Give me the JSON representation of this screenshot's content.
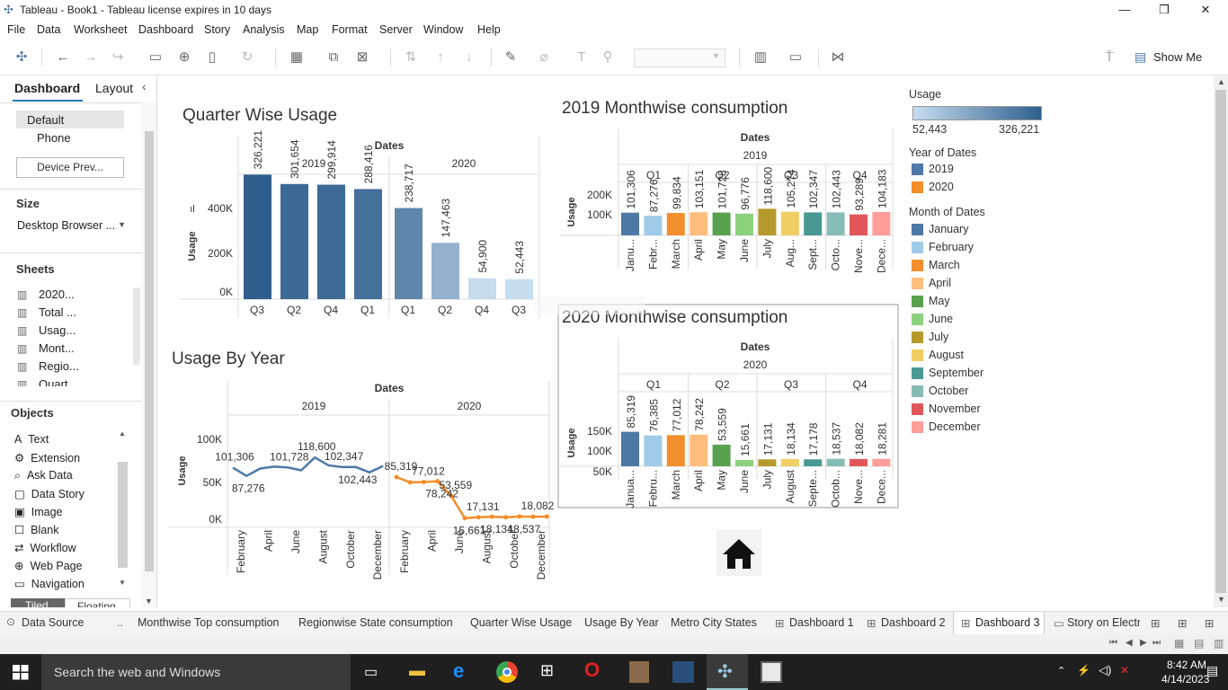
{
  "window": {
    "title": "Tableau - Book1 - Tableau license expires in 10 days"
  },
  "menu": [
    "File",
    "Data",
    "Worksheet",
    "Dashboard",
    "Story",
    "Analysis",
    "Map",
    "Format",
    "Server",
    "Window",
    "Help"
  ],
  "toolbar": {
    "show_me": "Show Me"
  },
  "left": {
    "tabs": [
      "Dashboard",
      "Layout"
    ],
    "device": [
      "Default",
      "Phone"
    ],
    "device_preview": "Device Prev...",
    "size_label": "Size",
    "size_value": "Desktop Browser ...",
    "sheets_label": "Sheets",
    "sheets": [
      "2020...",
      "Total ...",
      "Usag...",
      "Mont...",
      "Regio...",
      "Quart"
    ],
    "objects_label": "Objects",
    "objects": [
      "Text",
      "Extension",
      "Ask Data",
      "Data Story",
      "Image",
      "Blank",
      "Workflow",
      "Web Page",
      "Navigation"
    ],
    "layout_tabs": [
      "Tiled",
      "Floating"
    ]
  },
  "sheet_tabs": [
    "Data Source",
    "Monthwise Top consumption",
    "Regionwise State consumption",
    "Quarter Wise Usage",
    "Usage By Year",
    "Metro City States",
    "Dashboard 1",
    "Dashboard 2",
    "Dashboard 3",
    "Story on Electr"
  ],
  "taskbar": {
    "search": "Search the web and Windows",
    "time": "8:42 AM",
    "date": "4/14/2023"
  },
  "legend": {
    "usage_title": "Usage",
    "usage_min": "52,443",
    "usage_max": "326,221",
    "year_title": "Year of Dates",
    "years": [
      {
        "name": "2019",
        "color": "#4e79a7"
      },
      {
        "name": "2020",
        "color": "#f28e2b"
      }
    ],
    "month_title": "Month of Dates",
    "months": [
      {
        "name": "January",
        "color": "#4e79a7"
      },
      {
        "name": "February",
        "color": "#a0cbe8"
      },
      {
        "name": "March",
        "color": "#f28e2b"
      },
      {
        "name": "April",
        "color": "#ffbe7d"
      },
      {
        "name": "May",
        "color": "#59a14f"
      },
      {
        "name": "June",
        "color": "#8cd17d"
      },
      {
        "name": "July",
        "color": "#b6992d"
      },
      {
        "name": "August",
        "color": "#f1ce63"
      },
      {
        "name": "September",
        "color": "#499894"
      },
      {
        "name": "October",
        "color": "#86bcb6"
      },
      {
        "name": "November",
        "color": "#e15759"
      },
      {
        "name": "December",
        "color": "#ff9d9a"
      }
    ]
  },
  "chart_data": [
    {
      "type": "bar",
      "title": "Quarter Wise Usage",
      "header": "Dates",
      "ylabel": "Usage",
      "groups": [
        {
          "name": "2019",
          "categories": [
            "Q3",
            "Q2",
            "Q4",
            "Q1"
          ],
          "values": [
            326221,
            301654,
            299914,
            288416
          ],
          "labels": [
            "326,221",
            "301,654",
            "299,914",
            "288,416"
          ]
        },
        {
          "name": "2020",
          "categories": [
            "Q1",
            "Q2",
            "Q4",
            "Q3"
          ],
          "values": [
            238717,
            147463,
            54900,
            52443
          ],
          "labels": [
            "238,717",
            "147,463",
            "54,900",
            "52,443"
          ]
        }
      ],
      "yticks": [
        "0K",
        "200K",
        "400K"
      ],
      "ylim": [
        0,
        400000
      ]
    },
    {
      "type": "line",
      "title": "Usage By Year",
      "header": "Dates",
      "ylabel": "Usage",
      "yticks": [
        "0K",
        "50K",
        "100K"
      ],
      "ylim": [
        0,
        125000
      ],
      "xticks": [
        "February",
        "April",
        "June",
        "August",
        "October",
        "December"
      ],
      "series": [
        {
          "name": "2019",
          "values": [
            101306,
            87276,
            99834,
            103151,
            101728,
            96776,
            118600,
            105274,
            102347,
            102443,
            93289,
            104183
          ],
          "labels": [
            "101,306",
            "87,276",
            "",
            "",
            "101,728",
            "",
            "118,600",
            "",
            "102,347",
            "102,443",
            "",
            ""
          ]
        },
        {
          "name": "2020",
          "values": [
            85319,
            76385,
            77012,
            78242,
            53559,
            15661,
            17131,
            18134,
            17178,
            18537,
            18082,
            18281
          ],
          "labels": [
            "85,319",
            "",
            "77,012",
            "78,242",
            "53,559",
            "15,661",
            "17,131",
            "18,134",
            "",
            "18,537",
            "18,082",
            ""
          ]
        }
      ]
    },
    {
      "type": "bar",
      "title": "2019 Monthwise consumption",
      "header": "Dates",
      "year": "2019",
      "ylabel": "Usage",
      "yticks": [
        "100K",
        "200K"
      ],
      "ylim": [
        0,
        250000
      ],
      "quarters": [
        "Q1",
        "Q2",
        "Q3",
        "Q4"
      ],
      "categories": [
        "Janu...",
        "Febr...",
        "March",
        "April",
        "May",
        "June",
        "July",
        "Aug...",
        "Sept...",
        "Octo...",
        "Nove...",
        "Dece..."
      ],
      "values": [
        101306,
        87276,
        99834,
        103151,
        101728,
        96776,
        118600,
        105274,
        102347,
        102443,
        93289,
        104183
      ],
      "labels": [
        "101,306",
        "87,276",
        "99,834",
        "103,151",
        "101,728",
        "96,776",
        "118,600",
        "105,274",
        "102,347",
        "102,443",
        "93,289",
        "104,183"
      ]
    },
    {
      "type": "bar",
      "title": "2020 Monthwise consumption",
      "header": "Dates",
      "year": "2020",
      "ylabel": "Usage",
      "yticks": [
        "50K",
        "100K",
        "150K"
      ],
      "ylim": [
        0,
        175000
      ],
      "quarters": [
        "Q1",
        "Q2",
        "Q3",
        "Q4"
      ],
      "categories": [
        "Janua...",
        "Febru...",
        "March",
        "April",
        "May",
        "June",
        "July",
        "August",
        "Septe...",
        "Octob...",
        "Nove...",
        "Dece..."
      ],
      "values": [
        85319,
        76385,
        77012,
        78242,
        53559,
        15661,
        17131,
        18134,
        17178,
        18537,
        18082,
        18281
      ],
      "labels": [
        "85,319",
        "76,385",
        "77,012",
        "78,242",
        "53,559",
        "15,661",
        "17,131",
        "18,134",
        "17,178",
        "18,537",
        "18,082",
        "18,281"
      ]
    }
  ]
}
